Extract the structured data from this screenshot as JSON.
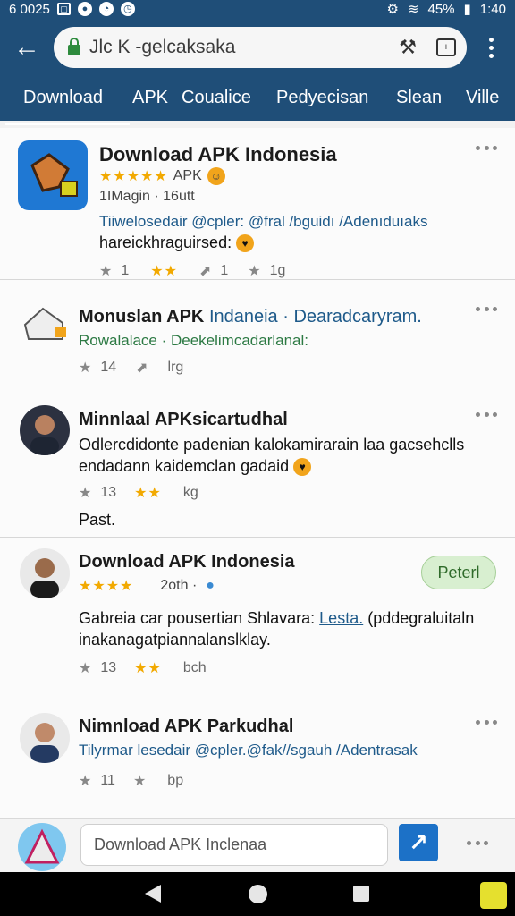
{
  "status_bar": {
    "left_text": "6 0025",
    "battery": "45%",
    "time": "1:40"
  },
  "browser": {
    "url": "Jlc K -gelcaksaka",
    "icons": [
      "back-arrow-icon",
      "lock-icon",
      "share-icon",
      "tab-switcher-icon",
      "overflow-menu-icon"
    ]
  },
  "tabs": [
    "Download",
    "APK",
    "Coualice",
    "Pedyecisan",
    "Slean",
    "Ville"
  ],
  "posts": [
    {
      "title": "Download APK Indonesia",
      "rating_label": "APK",
      "sub": "1IMagin · 16utt",
      "link": "Tiiwelosedair @cpler: @fral /bguidı /Adenıduıaks",
      "body": "hareickhraguirsed:",
      "stats": [
        "1",
        "1",
        "1g"
      ]
    },
    {
      "title": "Monuslan APK",
      "title_link": "Indaneia · Dearadcaryram.",
      "green_line": "Rowalalace · Deekelimcadarlanal:",
      "stats": [
        "14",
        "lrg"
      ]
    },
    {
      "title": "Minnlaal APKsicartudhal",
      "body": [
        "Odlercdidonte padenian kalokamirarain laa gacsehclls",
        "endadann kaidemclan gadaid"
      ],
      "stats": [
        "13",
        "kg"
      ],
      "footer": "Past."
    },
    {
      "title": "Download APK Indonesia",
      "sub": "2oth ·",
      "button": "Peterl",
      "body_prefix": "Gabreia car pousertian Shlavara:",
      "body_link": "Lesta.",
      "body_suffix": "(pddegraluitaln",
      "body_line2": "inakanagatpiannalanslklay.",
      "stats": [
        "13",
        "bch"
      ]
    },
    {
      "title": "Nimnload APK Parkudhal",
      "link": "Tilyrmar lesedair @cpler.@fak//sgauh /Adentrasak",
      "stats": [
        "11",
        "bp"
      ]
    }
  ],
  "comment_bar": {
    "placeholder": "Download APK Inclenaa"
  },
  "colors": {
    "header": "#1f4e78",
    "link": "#1e5a8a",
    "star": "#f2a900",
    "send": "#1c71c7"
  }
}
